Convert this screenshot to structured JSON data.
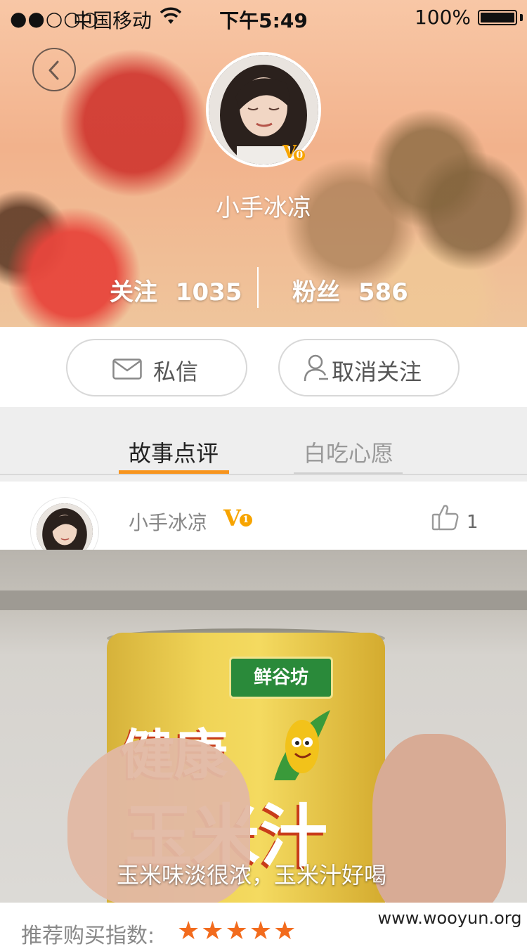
{
  "status_bar": {
    "signal": "●●○○○",
    "carrier": "中国移动",
    "time": "下午5:49",
    "battery": "100%"
  },
  "profile": {
    "name": "小手冰凉",
    "vip_badge": "V",
    "vip_level": "0",
    "follow_label": "关注",
    "follow_count": "1035",
    "fans_label": "粉丝",
    "fans_count": "586"
  },
  "actions": {
    "message_label": "私信",
    "unfollow_label": "取消关注"
  },
  "tabs": [
    {
      "label": "故事点评",
      "active": true
    },
    {
      "label": "白吃心愿",
      "active": false
    }
  ],
  "post": {
    "author": "小手冰凉",
    "vip_badge": "V",
    "vip_level": "1",
    "like_count": "1",
    "photo_text": {
      "brand": "鲜谷坊",
      "line1": "健康",
      "line2": "玉米汁"
    },
    "caption": "玉米味淡很浓，玉米汁好喝",
    "rating_label": "推荐购买指数:",
    "rating_stars": 5
  },
  "watermark": "www.wooyun.org",
  "colors": {
    "accent": "#f7941d",
    "star": "#f26b1d",
    "vip": "#f7a400"
  }
}
